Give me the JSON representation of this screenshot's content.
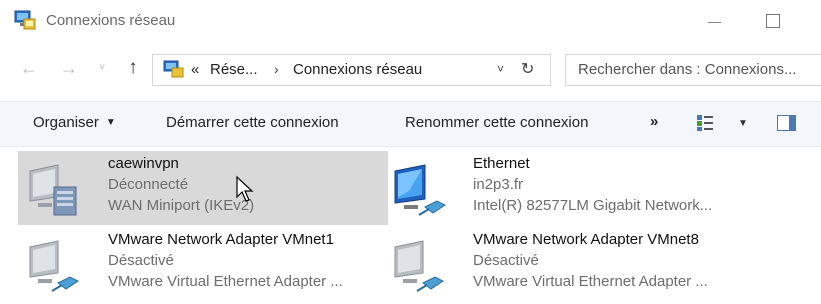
{
  "window": {
    "title": "Connexions réseau",
    "icon": "network-connections-icon"
  },
  "navigation": {
    "back": "←",
    "forward": "→",
    "recent": "˅",
    "up": "↑",
    "address": {
      "prefix": "«",
      "crumbs": [
        "Rése...",
        "Connexions réseau"
      ],
      "separator": "›",
      "dropdown": "˅",
      "refresh": "↻"
    },
    "search_placeholder": "Rechercher dans : Connexions..."
  },
  "commands": {
    "organise": "Organiser",
    "organise_caret": "▼",
    "start_connection": "Démarrer cette connexion",
    "rename_connection": "Renommer cette connexion",
    "more": "»",
    "view_caret": "▼"
  },
  "connections": [
    {
      "name": "caewinvpn",
      "status": "Déconnecté",
      "device": "WAN Miniport (IKEv2)",
      "icon": "vpn-connection-icon",
      "selected": true
    },
    {
      "name": "Ethernet",
      "status": "in2p3.fr",
      "device": "Intel(R) 82577LM Gigabit Network...",
      "icon": "ethernet-connection-icon",
      "selected": false
    },
    {
      "name": "VMware Network Adapter VMnet1",
      "status": "Désactivé",
      "device": "VMware Virtual Ethernet Adapter ...",
      "icon": "network-adapter-icon",
      "selected": false
    },
    {
      "name": "VMware Network Adapter VMnet8",
      "status": "Désactivé",
      "device": "VMware Virtual Ethernet Adapter ...",
      "icon": "network-adapter-icon",
      "selected": false
    }
  ],
  "colors": {
    "selection": "#d9d9d9",
    "commandbar": "#f3f6fa",
    "secondary_text": "#6d6d6d"
  }
}
